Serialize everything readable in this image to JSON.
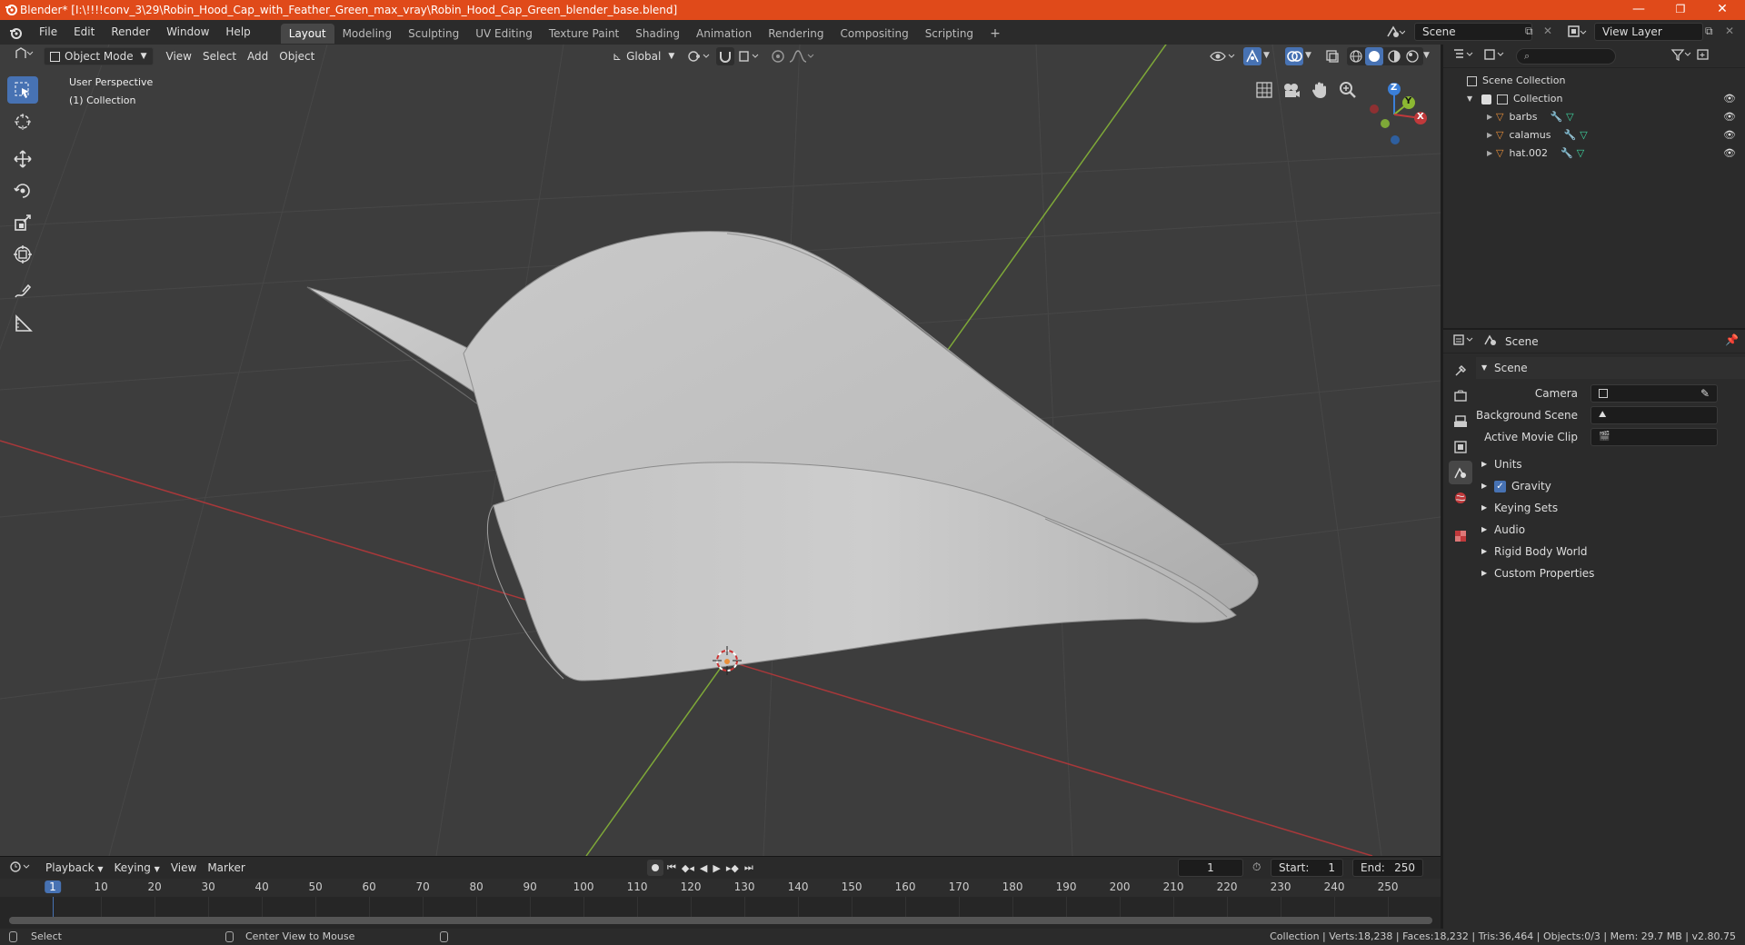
{
  "window": {
    "title": "Blender* [I:\\!!!!conv_3\\29\\Robin_Hood_Cap_with_Feather_Green_max_vray\\Robin_Hood_Cap_Green_blender_base.blend]",
    "minimize": "—",
    "restore": "❐",
    "close": "✕"
  },
  "menu": {
    "items": [
      "File",
      "Edit",
      "Render",
      "Window",
      "Help"
    ],
    "workspaces": [
      "Layout",
      "Modeling",
      "Sculpting",
      "UV Editing",
      "Texture Paint",
      "Shading",
      "Animation",
      "Rendering",
      "Compositing",
      "Scripting"
    ],
    "add_tab": "+",
    "scene_name": "Scene",
    "view_layer": "View Layer"
  },
  "viewport": {
    "mode": "Object Mode",
    "menus": [
      "View",
      "Select",
      "Add",
      "Object"
    ],
    "orientation": "Global",
    "overlay_title": "User Perspective",
    "overlay_collection": "(1) Collection",
    "gizmo": {
      "x": "X",
      "y": "Y",
      "z": "Z"
    }
  },
  "outliner": {
    "root": "Scene Collection",
    "collection": "Collection",
    "objects": [
      "barbs",
      "calamus",
      "hat.002"
    ]
  },
  "properties": {
    "context": "Scene",
    "panel": "Scene",
    "fields": [
      {
        "label": "Camera"
      },
      {
        "label": "Background Scene"
      },
      {
        "label": "Active Movie Clip"
      }
    ],
    "subpanels": [
      "Units",
      "Gravity",
      "Keying Sets",
      "Audio",
      "Rigid Body World",
      "Custom Properties"
    ]
  },
  "timeline": {
    "menus": [
      "Playback",
      "Keying",
      "View",
      "Marker"
    ],
    "current_frame": "1",
    "start_label": "Start:",
    "start": "1",
    "end_label": "End:",
    "end": "250",
    "ruler": [
      "1",
      "10",
      "20",
      "30",
      "40",
      "50",
      "60",
      "70",
      "80",
      "90",
      "100",
      "110",
      "120",
      "130",
      "140",
      "150",
      "160",
      "170",
      "180",
      "190",
      "200",
      "210",
      "220",
      "230",
      "240",
      "250"
    ]
  },
  "status": {
    "left1": "Select",
    "left2": "Center View to Mouse",
    "right": "Collection | Verts:18,238 | Faces:18,232 | Tris:36,464 | Objects:0/3 | Mem: 29.7 MB | v2.80.75"
  },
  "colors": {
    "accent": "#4772b3",
    "titlebar": "#e04a1a",
    "viewport_bg": "#3d3d3d",
    "x_axis": "#c0393b",
    "y_axis": "#8cb832",
    "z_axis": "#3b7fd8",
    "mesh_icon": "#e88f3a"
  }
}
